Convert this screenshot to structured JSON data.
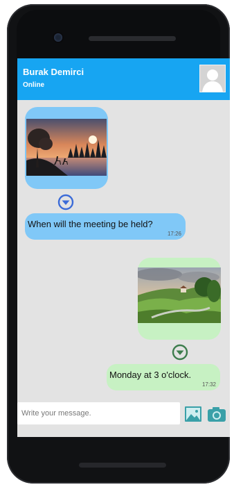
{
  "chat": {
    "contact_name": "Burak Demirci",
    "status": "Online",
    "messages": [
      {
        "direction": "incoming",
        "type": "image",
        "icon": "download-icon"
      },
      {
        "direction": "incoming",
        "type": "text",
        "text": "When will the meeting be held?",
        "time": "17:26"
      },
      {
        "direction": "outgoing",
        "type": "image",
        "icon": "download-icon"
      },
      {
        "direction": "outgoing",
        "type": "text",
        "text": "Monday at 3 o'clock.",
        "time": "17:32"
      }
    ]
  },
  "composer": {
    "placeholder": "Write your message.",
    "gallery_icon": "image-gallery-icon",
    "camera_icon": "camera-icon"
  },
  "colors": {
    "header": "#17a5f2",
    "incoming_bubble": "#80c8f7",
    "outgoing_bubble": "#c7f1c3",
    "chat_background": "#e3e3e3",
    "incoming_download_icon": "#3b6bd8",
    "outgoing_download_icon": "#3d7d4d",
    "composer_icons": "#3aa0a8"
  }
}
